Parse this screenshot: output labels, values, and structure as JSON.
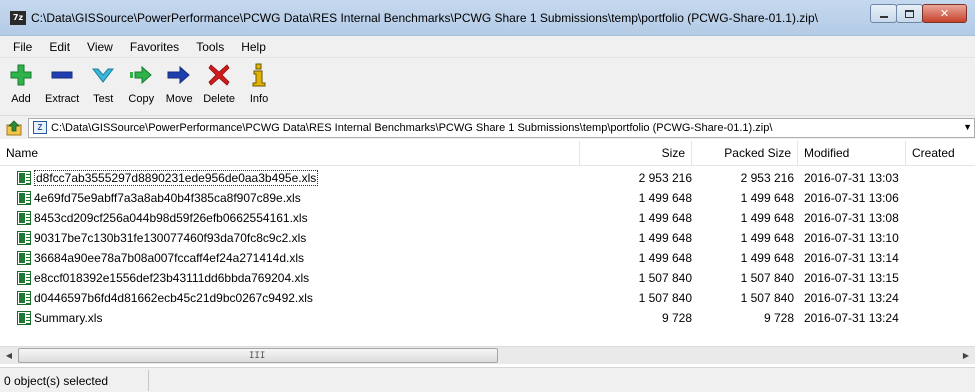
{
  "window": {
    "title": "C:\\Data\\GISSource\\PowerPerformance\\PCWG Data\\RES Internal Benchmarks\\PCWG Share 1 Submissions\\temp\\portfolio (PCWG-Share-01.1).zip\\",
    "app_icon_text": "7z"
  },
  "menu": {
    "items": [
      "File",
      "Edit",
      "View",
      "Favorites",
      "Tools",
      "Help"
    ]
  },
  "toolbar": {
    "buttons": [
      {
        "label": "Add",
        "icon": "plus-icon",
        "color": "#2db34a"
      },
      {
        "label": "Extract",
        "icon": "minus-icon",
        "color": "#1f3fb0"
      },
      {
        "label": "Test",
        "icon": "checkmark-icon",
        "color": "#2aa7c9"
      },
      {
        "label": "Copy",
        "icon": "copy-arrows-icon",
        "color": "#2db34a"
      },
      {
        "label": "Move",
        "icon": "move-arrow-icon",
        "color": "#1f3fb0"
      },
      {
        "label": "Delete",
        "icon": "delete-x-icon",
        "color": "#d11b1b"
      },
      {
        "label": "Info",
        "icon": "info-icon",
        "color": "#c8a200"
      }
    ]
  },
  "address": {
    "path": "C:\\Data\\GISSource\\PowerPerformance\\PCWG Data\\RES Internal Benchmarks\\PCWG Share 1 Submissions\\temp\\portfolio (PCWG-Share-01.1).zip\\",
    "zip_icon_text": "Z"
  },
  "list": {
    "columns": [
      "Name",
      "Size",
      "Packed Size",
      "Modified",
      "Created"
    ],
    "rows": [
      {
        "name": "d8fcc7ab3555297d8890231ede956de0aa3b495e.xls",
        "size": "2 953 216",
        "packed": "2 953 216",
        "modified": "2016-07-31 13:03"
      },
      {
        "name": "4e69fd75e9abff7a3a8ab40b4f385ca8f907c89e.xls",
        "size": "1 499 648",
        "packed": "1 499 648",
        "modified": "2016-07-31 13:06"
      },
      {
        "name": "8453cd209cf256a044b98d59f26efb0662554161.xls",
        "size": "1 499 648",
        "packed": "1 499 648",
        "modified": "2016-07-31 13:08"
      },
      {
        "name": "90317be7c130b31fe130077460f93da70fc8c9c2.xls",
        "size": "1 499 648",
        "packed": "1 499 648",
        "modified": "2016-07-31 13:10"
      },
      {
        "name": "36684a90ee78a7b08a007fccaff4ef24a271414d.xls",
        "size": "1 499 648",
        "packed": "1 499 648",
        "modified": "2016-07-31 13:14"
      },
      {
        "name": "e8ccf018392e1556def23b43111dd6bbda769204.xls",
        "size": "1 507 840",
        "packed": "1 507 840",
        "modified": "2016-07-31 13:15"
      },
      {
        "name": "d0446597b6fd4d81662ecb45c21d9bc0267c9492.xls",
        "size": "1 507 840",
        "packed": "1 507 840",
        "modified": "2016-07-31 13:24"
      },
      {
        "name": "Summary.xls",
        "size": "9 728",
        "packed": "9 728",
        "modified": "2016-07-31 13:24"
      }
    ]
  },
  "scrollbar": {
    "grip": "III"
  },
  "status": {
    "text": "0 object(s) selected"
  }
}
